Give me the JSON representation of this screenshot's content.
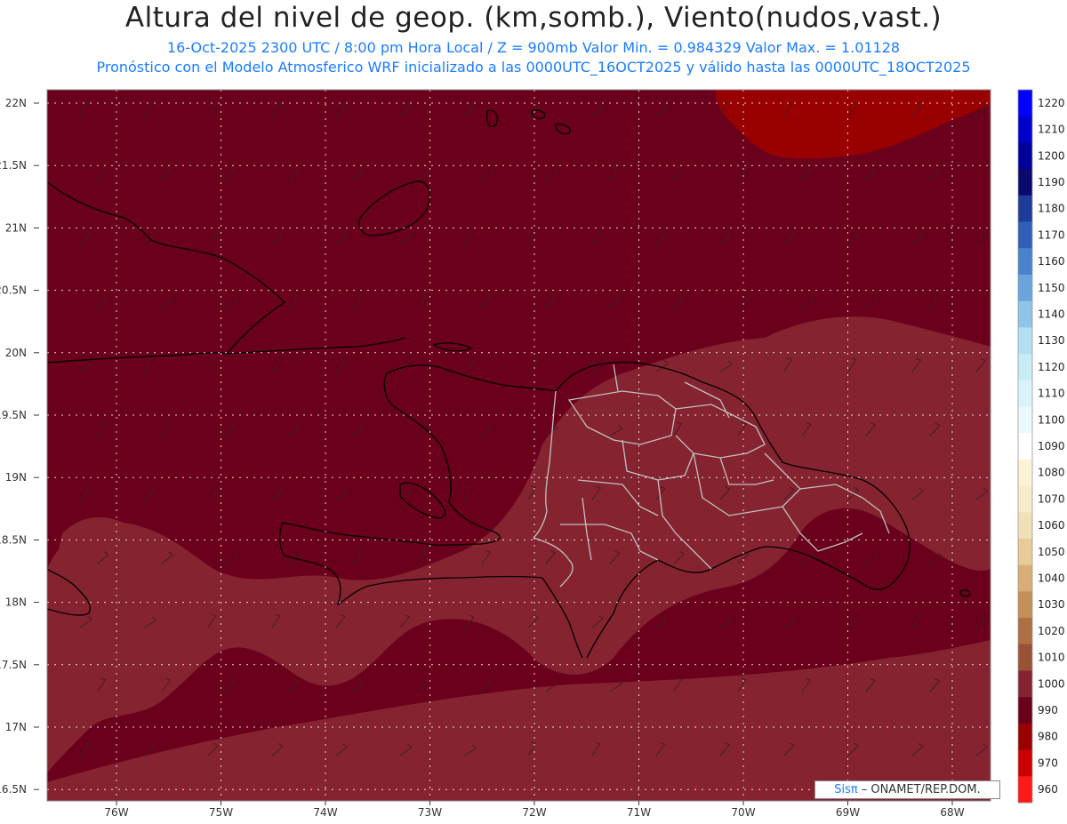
{
  "title": "Altura del nivel de geop. (km,somb.), Viento(nudos,vast.)",
  "subtitle1": "16-Oct-2025   2300 UTC / 8:00 pm Hora Local / Z = 900mb    Valor Min. = 0.984329   Valor Max. = 1.01128",
  "subtitle2": "Pronóstico con el Modelo Atmosferico WRF inicializado a las 0000UTC_16OCT2025 y válido hasta las  0000UTC_18OCT2025",
  "lat_labels": [
    "22N",
    "21.5N",
    "21N",
    "20.5N",
    "20N",
    "19.5N",
    "19N",
    "18.5N",
    "18N",
    "17.5N",
    "17N",
    "16.5N"
  ],
  "lon_labels": [
    "76W",
    "75W",
    "74W",
    "73W",
    "72W",
    "71W",
    "70W",
    "69W",
    "68W"
  ],
  "colorbar": {
    "levels": [
      "1220",
      "1210",
      "1200",
      "1190",
      "1180",
      "1170",
      "1160",
      "1150",
      "1140",
      "1130",
      "1120",
      "1110",
      "1100",
      "1090",
      "1080",
      "1070",
      "1060",
      "1050",
      "1040",
      "1030",
      "1020",
      "1010",
      "1000",
      "990",
      "980",
      "970",
      "960"
    ],
    "colors": [
      "#0000ff",
      "#0000cc",
      "#00009a",
      "#0a0a6e",
      "#1e3c9c",
      "#2f5fb8",
      "#4a82cc",
      "#6aa4dc",
      "#8ec4e8",
      "#b2e0f2",
      "#c8ecf6",
      "#d8f4fa",
      "#e8fafd",
      "#ffffff",
      "#fbf3d6",
      "#f6eccb",
      "#f0e0b8",
      "#e7cc98",
      "#d8ae76",
      "#c4905a",
      "#ad6f44",
      "#9a5236",
      "#852430",
      "#6a001c",
      "#990000",
      "#cc0000",
      "#ff1a1a"
    ]
  },
  "field_colors": {
    "base": "#6a001c",
    "low": "#852430",
    "high": "#990000"
  },
  "credit": {
    "brand": "Sisπ",
    "text": "– ONAMET/REP.DOM."
  },
  "value_range": {
    "min": 0.984329,
    "max": 1.01128,
    "units": "km"
  },
  "map_region": {
    "lon": [
      -76.6,
      -67.6
    ],
    "lat": [
      16.4,
      22.1
    ],
    "level_mb": 900
  }
}
